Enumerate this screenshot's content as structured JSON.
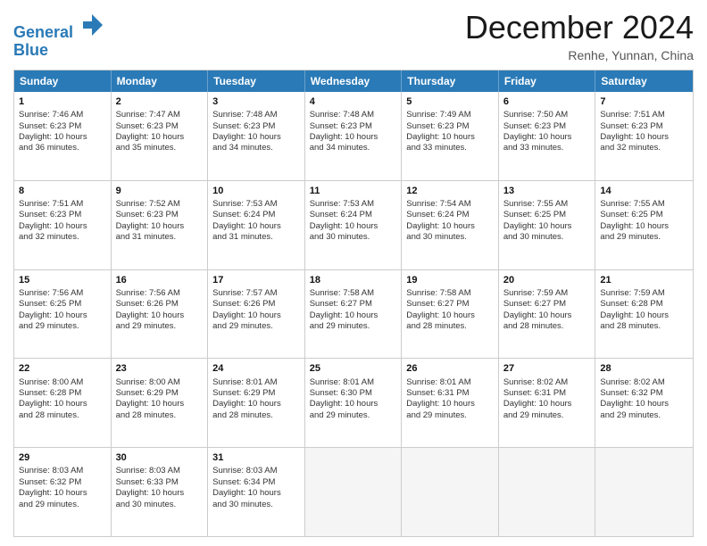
{
  "logo": {
    "line1": "General",
    "line2": "Blue",
    "icon": "▶"
  },
  "title": "December 2024",
  "location": "Renhe, Yunnan, China",
  "header_days": [
    "Sunday",
    "Monday",
    "Tuesday",
    "Wednesday",
    "Thursday",
    "Friday",
    "Saturday"
  ],
  "weeks": [
    [
      {
        "day": "1",
        "lines": [
          "Sunrise: 7:46 AM",
          "Sunset: 6:23 PM",
          "Daylight: 10 hours",
          "and 36 minutes."
        ]
      },
      {
        "day": "2",
        "lines": [
          "Sunrise: 7:47 AM",
          "Sunset: 6:23 PM",
          "Daylight: 10 hours",
          "and 35 minutes."
        ]
      },
      {
        "day": "3",
        "lines": [
          "Sunrise: 7:48 AM",
          "Sunset: 6:23 PM",
          "Daylight: 10 hours",
          "and 34 minutes."
        ]
      },
      {
        "day": "4",
        "lines": [
          "Sunrise: 7:48 AM",
          "Sunset: 6:23 PM",
          "Daylight: 10 hours",
          "and 34 minutes."
        ]
      },
      {
        "day": "5",
        "lines": [
          "Sunrise: 7:49 AM",
          "Sunset: 6:23 PM",
          "Daylight: 10 hours",
          "and 33 minutes."
        ]
      },
      {
        "day": "6",
        "lines": [
          "Sunrise: 7:50 AM",
          "Sunset: 6:23 PM",
          "Daylight: 10 hours",
          "and 33 minutes."
        ]
      },
      {
        "day": "7",
        "lines": [
          "Sunrise: 7:51 AM",
          "Sunset: 6:23 PM",
          "Daylight: 10 hours",
          "and 32 minutes."
        ]
      }
    ],
    [
      {
        "day": "8",
        "lines": [
          "Sunrise: 7:51 AM",
          "Sunset: 6:23 PM",
          "Daylight: 10 hours",
          "and 32 minutes."
        ]
      },
      {
        "day": "9",
        "lines": [
          "Sunrise: 7:52 AM",
          "Sunset: 6:23 PM",
          "Daylight: 10 hours",
          "and 31 minutes."
        ]
      },
      {
        "day": "10",
        "lines": [
          "Sunrise: 7:53 AM",
          "Sunset: 6:24 PM",
          "Daylight: 10 hours",
          "and 31 minutes."
        ]
      },
      {
        "day": "11",
        "lines": [
          "Sunrise: 7:53 AM",
          "Sunset: 6:24 PM",
          "Daylight: 10 hours",
          "and 30 minutes."
        ]
      },
      {
        "day": "12",
        "lines": [
          "Sunrise: 7:54 AM",
          "Sunset: 6:24 PM",
          "Daylight: 10 hours",
          "and 30 minutes."
        ]
      },
      {
        "day": "13",
        "lines": [
          "Sunrise: 7:55 AM",
          "Sunset: 6:25 PM",
          "Daylight: 10 hours",
          "and 30 minutes."
        ]
      },
      {
        "day": "14",
        "lines": [
          "Sunrise: 7:55 AM",
          "Sunset: 6:25 PM",
          "Daylight: 10 hours",
          "and 29 minutes."
        ]
      }
    ],
    [
      {
        "day": "15",
        "lines": [
          "Sunrise: 7:56 AM",
          "Sunset: 6:25 PM",
          "Daylight: 10 hours",
          "and 29 minutes."
        ]
      },
      {
        "day": "16",
        "lines": [
          "Sunrise: 7:56 AM",
          "Sunset: 6:26 PM",
          "Daylight: 10 hours",
          "and 29 minutes."
        ]
      },
      {
        "day": "17",
        "lines": [
          "Sunrise: 7:57 AM",
          "Sunset: 6:26 PM",
          "Daylight: 10 hours",
          "and 29 minutes."
        ]
      },
      {
        "day": "18",
        "lines": [
          "Sunrise: 7:58 AM",
          "Sunset: 6:27 PM",
          "Daylight: 10 hours",
          "and 29 minutes."
        ]
      },
      {
        "day": "19",
        "lines": [
          "Sunrise: 7:58 AM",
          "Sunset: 6:27 PM",
          "Daylight: 10 hours",
          "and 28 minutes."
        ]
      },
      {
        "day": "20",
        "lines": [
          "Sunrise: 7:59 AM",
          "Sunset: 6:27 PM",
          "Daylight: 10 hours",
          "and 28 minutes."
        ]
      },
      {
        "day": "21",
        "lines": [
          "Sunrise: 7:59 AM",
          "Sunset: 6:28 PM",
          "Daylight: 10 hours",
          "and 28 minutes."
        ]
      }
    ],
    [
      {
        "day": "22",
        "lines": [
          "Sunrise: 8:00 AM",
          "Sunset: 6:28 PM",
          "Daylight: 10 hours",
          "and 28 minutes."
        ]
      },
      {
        "day": "23",
        "lines": [
          "Sunrise: 8:00 AM",
          "Sunset: 6:29 PM",
          "Daylight: 10 hours",
          "and 28 minutes."
        ]
      },
      {
        "day": "24",
        "lines": [
          "Sunrise: 8:01 AM",
          "Sunset: 6:29 PM",
          "Daylight: 10 hours",
          "and 28 minutes."
        ]
      },
      {
        "day": "25",
        "lines": [
          "Sunrise: 8:01 AM",
          "Sunset: 6:30 PM",
          "Daylight: 10 hours",
          "and 29 minutes."
        ]
      },
      {
        "day": "26",
        "lines": [
          "Sunrise: 8:01 AM",
          "Sunset: 6:31 PM",
          "Daylight: 10 hours",
          "and 29 minutes."
        ]
      },
      {
        "day": "27",
        "lines": [
          "Sunrise: 8:02 AM",
          "Sunset: 6:31 PM",
          "Daylight: 10 hours",
          "and 29 minutes."
        ]
      },
      {
        "day": "28",
        "lines": [
          "Sunrise: 8:02 AM",
          "Sunset: 6:32 PM",
          "Daylight: 10 hours",
          "and 29 minutes."
        ]
      }
    ],
    [
      {
        "day": "29",
        "lines": [
          "Sunrise: 8:03 AM",
          "Sunset: 6:32 PM",
          "Daylight: 10 hours",
          "and 29 minutes."
        ]
      },
      {
        "day": "30",
        "lines": [
          "Sunrise: 8:03 AM",
          "Sunset: 6:33 PM",
          "Daylight: 10 hours",
          "and 30 minutes."
        ]
      },
      {
        "day": "31",
        "lines": [
          "Sunrise: 8:03 AM",
          "Sunset: 6:34 PM",
          "Daylight: 10 hours",
          "and 30 minutes."
        ]
      },
      null,
      null,
      null,
      null
    ]
  ]
}
